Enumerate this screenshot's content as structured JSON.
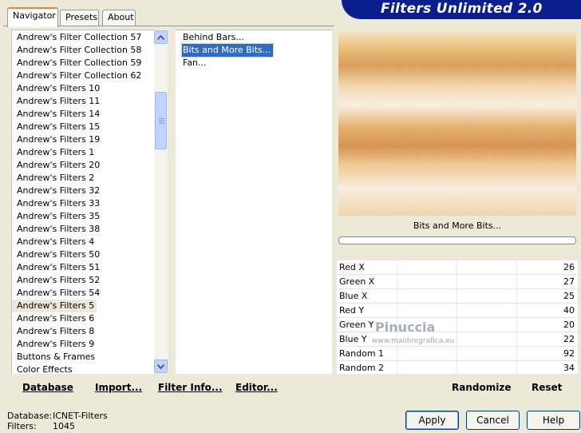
{
  "app_title": "Filters Unlimited 2.0",
  "tabs": [
    "Navigator",
    "Presets",
    "About"
  ],
  "categories": [
    "Andrew's Filter Collection 57",
    "Andrew's Filter Collection 58",
    "Andrew's Filter Collection 59",
    "Andrew's Filter Collection 62",
    "Andrew's Filters 10",
    "Andrew's Filters 11",
    "Andrew's Filters 14",
    "Andrew's Filters 15",
    "Andrew's Filters 19",
    "Andrew's Filters 1",
    "Andrew's Filters 20",
    "Andrew's Filters 2",
    "Andrew's Filters 32",
    "Andrew's Filters 33",
    "Andrew's Filters 35",
    "Andrew's Filters 38",
    "Andrew's Filters 4",
    "Andrew's Filters 50",
    "Andrew's Filters 51",
    "Andrew's Filters 52",
    "Andrew's Filters 54",
    "Andrew's Filters 5",
    "Andrew's Filters 6",
    "Andrew's Filters 8",
    "Andrew's Filters 9",
    "Buttons & Frames",
    "Color Effects"
  ],
  "selected_category": "Andrew's Filters 5",
  "filters": [
    "Behind Bars...",
    "Bits and More Bits...",
    "Fan..."
  ],
  "selected_filter": "Bits and More Bits...",
  "preview_filter_name": "Bits and More Bits...",
  "params": [
    {
      "label": "Red X",
      "value": "26"
    },
    {
      "label": "Green X",
      "value": "27"
    },
    {
      "label": "Blue X",
      "value": "25"
    },
    {
      "label": "Red Y",
      "value": "40"
    },
    {
      "label": "Green Y",
      "value": "20"
    },
    {
      "label": "Blue Y",
      "value": "22"
    },
    {
      "label": "Random 1",
      "value": "92"
    },
    {
      "label": "Random 2",
      "value": "34"
    }
  ],
  "watermark": "Pinuccia",
  "watermark_url": "www.maidiregrafica.eu",
  "bottom_links": {
    "database": "Database",
    "import": "Import...",
    "filter_info": "Filter Info...",
    "editor": "Editor...",
    "randomize": "Randomize",
    "reset": "Reset"
  },
  "status": {
    "database_label": "Database:",
    "database_value": "ICNET-Filters",
    "filters_label": "Filters:",
    "filters_value": "1045"
  },
  "buttons": {
    "apply": "Apply",
    "cancel": "Cancel",
    "help": "Help"
  },
  "colors": {
    "accent": "#316ac5",
    "banner": "#0a1e8c",
    "tab_highlight": "#e68b2c"
  }
}
